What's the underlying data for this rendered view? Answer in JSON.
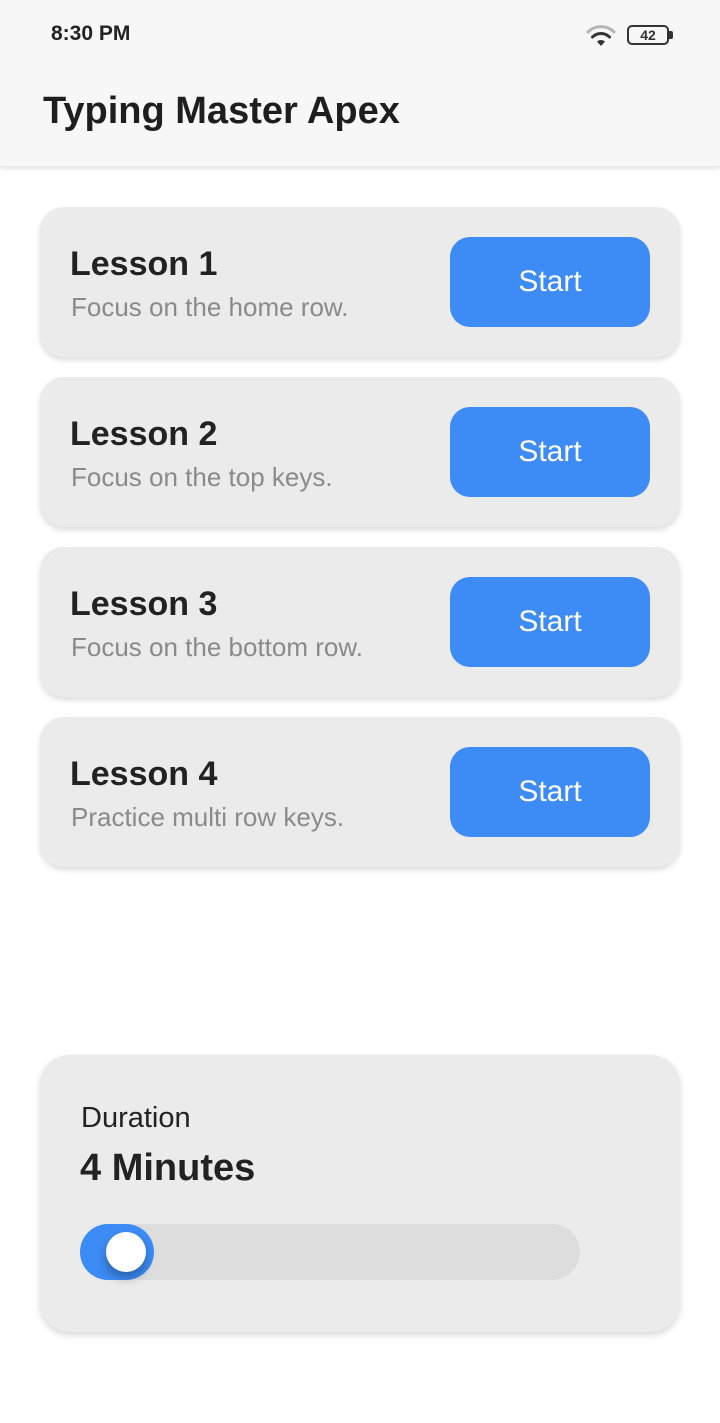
{
  "status_bar": {
    "time": "8:30 PM",
    "battery": "42",
    "wifi_icon": "wifi-icon",
    "battery_icon": "battery-icon"
  },
  "app_bar": {
    "title": "Typing Master Apex"
  },
  "lessons": [
    {
      "title": "Lesson 1",
      "description": "Focus on the home row.",
      "button": "Start"
    },
    {
      "title": "Lesson 2",
      "description": "Focus on the top keys.",
      "button": "Start"
    },
    {
      "title": "Lesson 3",
      "description": "Focus on the bottom row.",
      "button": "Start"
    },
    {
      "title": "Lesson 4",
      "description": "Practice multi row keys.",
      "button": "Start"
    }
  ],
  "duration": {
    "label": "Duration",
    "value": "4 Minutes",
    "slider_level": 0.04
  },
  "colors": {
    "accent": "#3d8bf5",
    "card_background": "#ebebeb",
    "secondary_text": "#8a8a8a"
  }
}
